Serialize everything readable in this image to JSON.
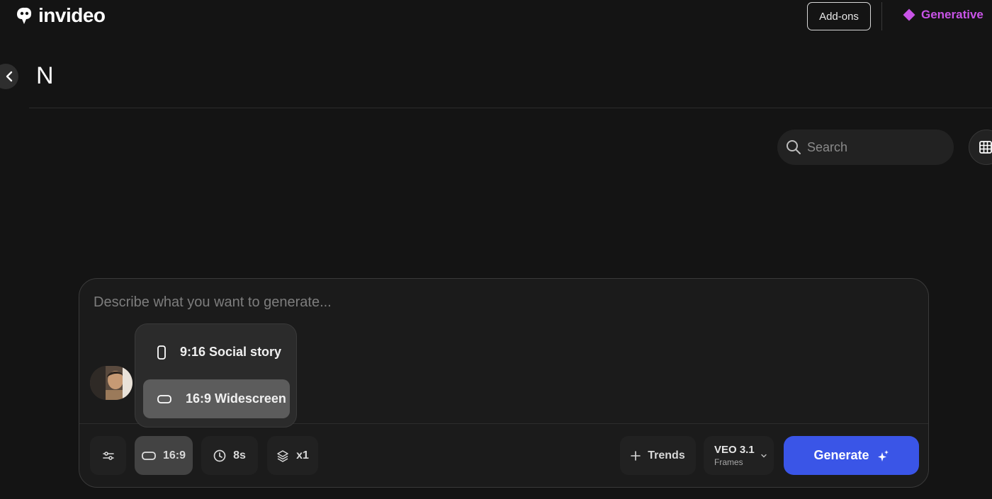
{
  "brand": {
    "name": "invideo"
  },
  "header": {
    "addons_label": "Add-ons",
    "plan_label": "Generative"
  },
  "page": {
    "title": "N"
  },
  "search": {
    "placeholder": "Search"
  },
  "composer": {
    "prompt_placeholder": "Describe what you want to generate...",
    "aspect_menu": {
      "items": [
        {
          "label": "9:16 Social story",
          "icon": "portrait-frame-icon",
          "selected": false
        },
        {
          "label": "16:9 Widescreen",
          "icon": "landscape-frame-icon",
          "selected": true
        }
      ]
    },
    "toolbar": {
      "ratio_label": "16:9",
      "duration_label": "8s",
      "count_label": "x1",
      "trends_label": "Trends",
      "model_name": "VEO 3.1",
      "model_mode": "Frames",
      "generate_label": "Generate"
    }
  },
  "colors": {
    "background": "#141414",
    "accent_purple": "#c954e8",
    "generate_blue": "#3a55e7"
  }
}
